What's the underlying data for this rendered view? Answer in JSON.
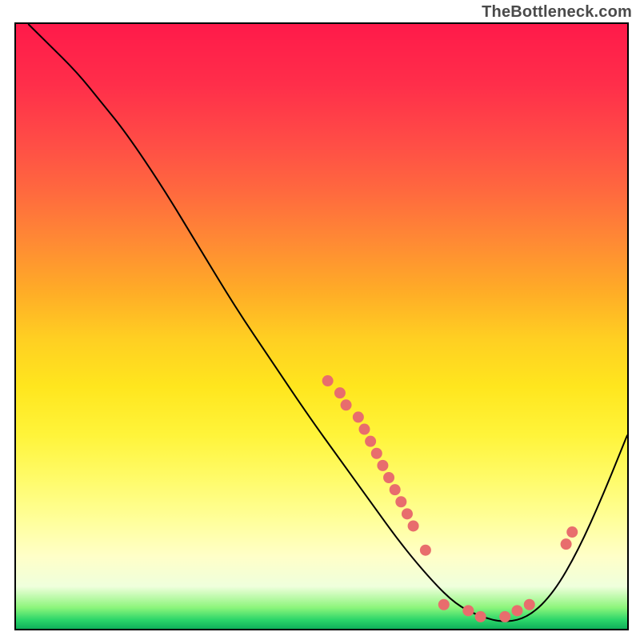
{
  "watermark": "TheBottleneck.com",
  "colors": {
    "gradient_stops": [
      {
        "offset": 0.0,
        "color": "#ff1a4a"
      },
      {
        "offset": 0.1,
        "color": "#ff2e4a"
      },
      {
        "offset": 0.2,
        "color": "#ff4e46"
      },
      {
        "offset": 0.28,
        "color": "#ff6a3e"
      },
      {
        "offset": 0.36,
        "color": "#ff8a34"
      },
      {
        "offset": 0.44,
        "color": "#ffab27"
      },
      {
        "offset": 0.52,
        "color": "#ffcf22"
      },
      {
        "offset": 0.6,
        "color": "#ffe61e"
      },
      {
        "offset": 0.68,
        "color": "#fff43a"
      },
      {
        "offset": 0.75,
        "color": "#fffb68"
      },
      {
        "offset": 0.82,
        "color": "#ffff9a"
      },
      {
        "offset": 0.88,
        "color": "#ffffc8"
      },
      {
        "offset": 0.93,
        "color": "#efffdc"
      },
      {
        "offset": 0.965,
        "color": "#8cf57b"
      },
      {
        "offset": 0.985,
        "color": "#2cd66a"
      },
      {
        "offset": 1.0,
        "color": "#0fb05a"
      }
    ],
    "curve": "#000000",
    "marker_fill": "#e86d6d",
    "marker_stroke": "#d85a5a"
  },
  "chart_data": {
    "type": "line",
    "title": "",
    "xlabel": "",
    "ylabel": "",
    "xlim": [
      0,
      100
    ],
    "ylim": [
      0,
      100
    ],
    "grid": false,
    "curve": [
      {
        "x": 2,
        "y": 100
      },
      {
        "x": 5,
        "y": 97
      },
      {
        "x": 10,
        "y": 92
      },
      {
        "x": 14,
        "y": 87
      },
      {
        "x": 18,
        "y": 82
      },
      {
        "x": 24,
        "y": 73
      },
      {
        "x": 30,
        "y": 63
      },
      {
        "x": 36,
        "y": 53
      },
      {
        "x": 42,
        "y": 44
      },
      {
        "x": 48,
        "y": 35
      },
      {
        "x": 53,
        "y": 28
      },
      {
        "x": 58,
        "y": 21
      },
      {
        "x": 63,
        "y": 14
      },
      {
        "x": 68,
        "y": 8
      },
      {
        "x": 72,
        "y": 4
      },
      {
        "x": 76,
        "y": 2
      },
      {
        "x": 80,
        "y": 1
      },
      {
        "x": 84,
        "y": 2
      },
      {
        "x": 88,
        "y": 6
      },
      {
        "x": 92,
        "y": 13
      },
      {
        "x": 96,
        "y": 22
      },
      {
        "x": 100,
        "y": 32
      }
    ],
    "markers": [
      {
        "x": 51,
        "y": 41
      },
      {
        "x": 53,
        "y": 39
      },
      {
        "x": 54,
        "y": 37
      },
      {
        "x": 56,
        "y": 35
      },
      {
        "x": 57,
        "y": 33
      },
      {
        "x": 58,
        "y": 31
      },
      {
        "x": 59,
        "y": 29
      },
      {
        "x": 60,
        "y": 27
      },
      {
        "x": 61,
        "y": 25
      },
      {
        "x": 62,
        "y": 23
      },
      {
        "x": 63,
        "y": 21
      },
      {
        "x": 64,
        "y": 19
      },
      {
        "x": 65,
        "y": 17
      },
      {
        "x": 67,
        "y": 13
      },
      {
        "x": 70,
        "y": 4
      },
      {
        "x": 74,
        "y": 3
      },
      {
        "x": 76,
        "y": 2
      },
      {
        "x": 80,
        "y": 2
      },
      {
        "x": 82,
        "y": 3
      },
      {
        "x": 84,
        "y": 4
      },
      {
        "x": 90,
        "y": 14
      },
      {
        "x": 91,
        "y": 16
      }
    ]
  }
}
